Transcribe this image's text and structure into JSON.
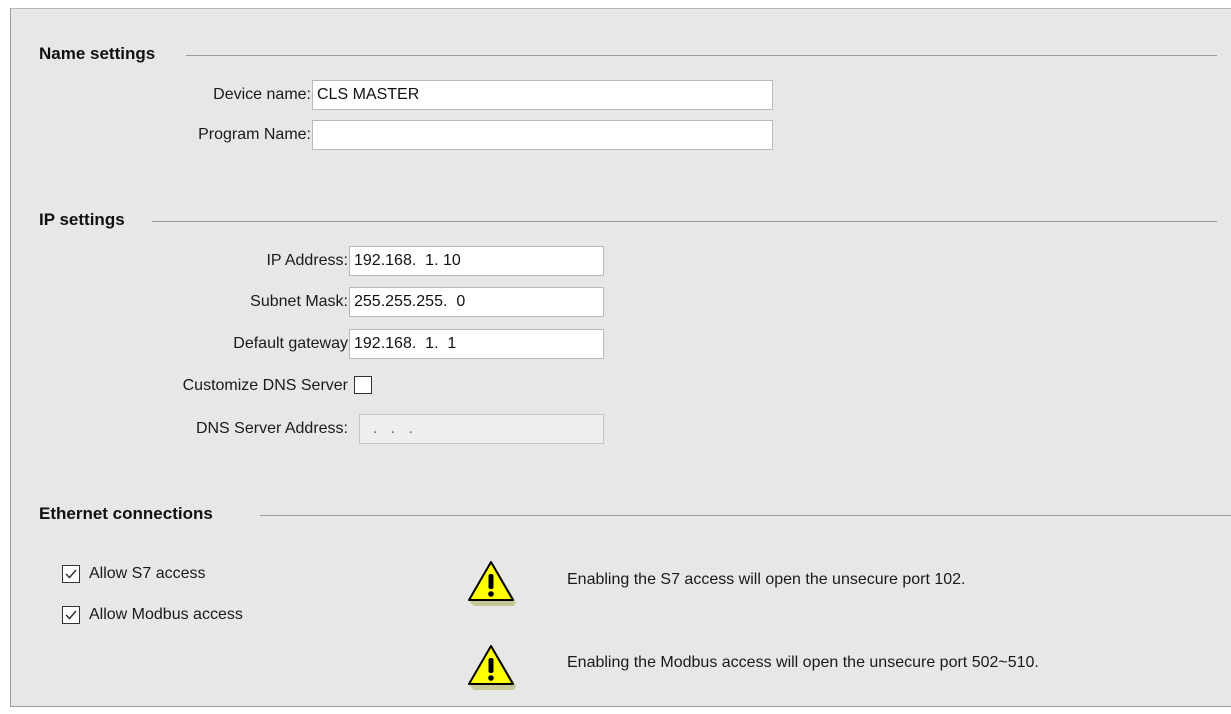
{
  "name_settings": {
    "title": "Name settings",
    "device_name_label": "Device name:",
    "device_name_value": "CLS MASTER",
    "program_name_label": "Program Name:",
    "program_name_value": ""
  },
  "ip_settings": {
    "title": "IP settings",
    "ip_address_label": "IP Address:",
    "ip_address_value": "192.168.  1. 10",
    "subnet_mask_label": "Subnet Mask:",
    "subnet_mask_value": "255.255.255.  0",
    "default_gateway_label": "Default gateway",
    "default_gateway_value": "192.168.  1.  1",
    "customize_dns_label": "Customize DNS Server",
    "customize_dns_checked": false,
    "dns_server_label": "DNS Server Address:",
    "dns_server_value": "  .   .   .  "
  },
  "ethernet": {
    "title": "Ethernet connections",
    "allow_s7_label": "Allow S7 access",
    "allow_s7_checked": true,
    "allow_modbus_label": "Allow Modbus access",
    "allow_modbus_checked": true,
    "warnings": [
      {
        "icon": "warning-icon",
        "text": "Enabling the S7 access will open the unsecure port 102."
      },
      {
        "icon": "warning-icon",
        "text": "Enabling the Modbus access will open the unsecure port 502~510."
      }
    ]
  },
  "colors": {
    "panel_bg": "#e7e7e7",
    "warning_fill": "#ffff00",
    "warning_stroke": "#000000"
  }
}
